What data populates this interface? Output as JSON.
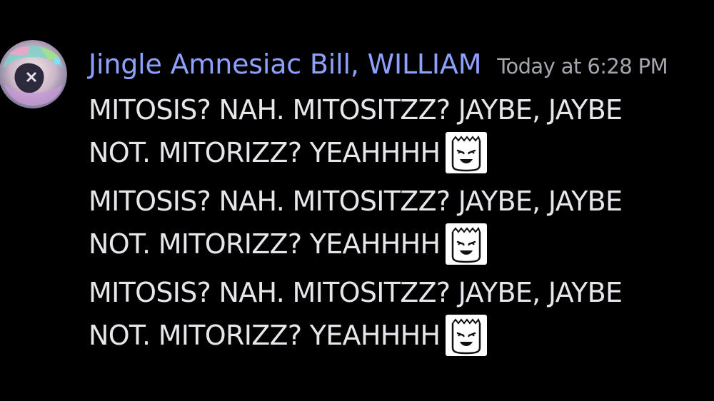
{
  "message": {
    "author": "Jingle Amnesiac Bill, WILLIAM",
    "timestamp": "Today at 6:28 PM",
    "lines": [
      "MITOSIS? NAH. MITOSITZZ? JAYBE, JAYBE",
      "NOT. MITORIZZ? YEAHHHH",
      "MITOSIS? NAH. MITOSITZZ? JAYBE, JAYBE",
      "NOT. MITORIZZ? YEAHHHH",
      "MITOSIS? NAH. MITOSITZZ? JAYBE, JAYBE",
      "NOT. MITORIZZ? YEAHHHH"
    ],
    "emoji": "smirk-bag-emoji",
    "colors": {
      "background": "#000000",
      "author": "#8ea1ff",
      "timestamp": "#a3a6ad",
      "text": "#e6e7ea"
    }
  }
}
